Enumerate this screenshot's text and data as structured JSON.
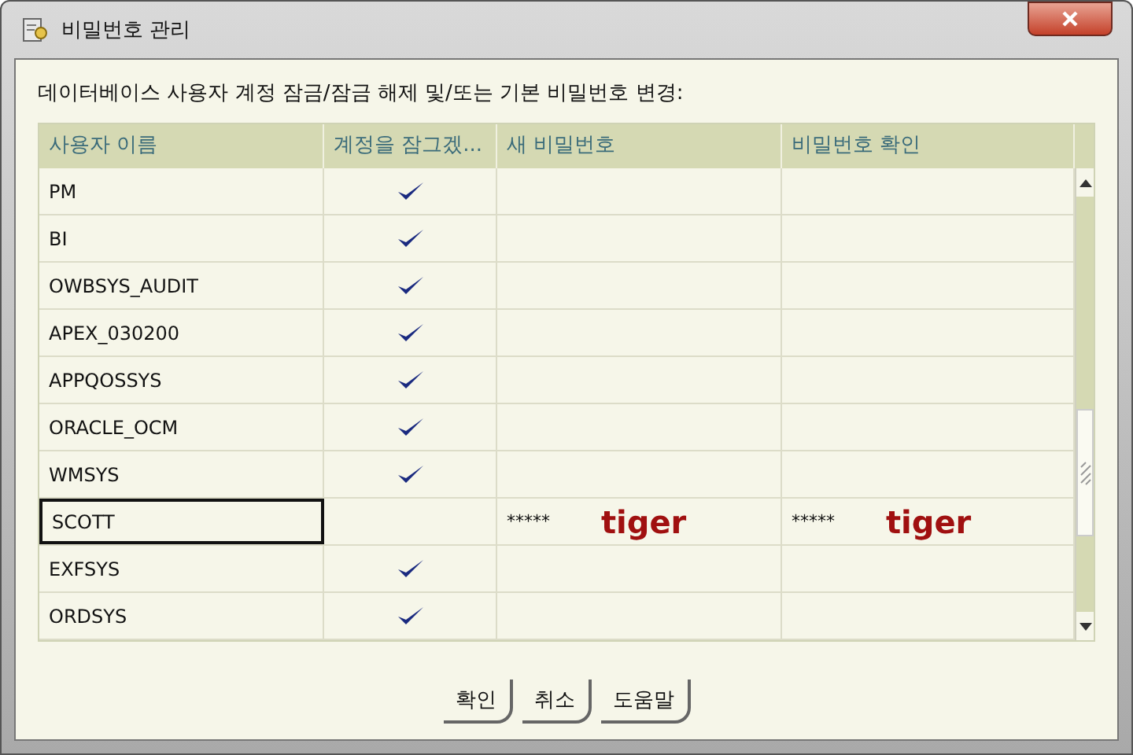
{
  "window": {
    "title": "비밀번호 관리"
  },
  "instruction": "데이터베이스 사용자 계정 잠금/잠금 해제 및/또는 기본 비밀번호 변경:",
  "table": {
    "columns": [
      "사용자 이름",
      "계정을 잠그겠...",
      "새 비밀번호",
      "비밀번호 확인"
    ],
    "rows": [
      {
        "user": "PM",
        "locked": true,
        "selected": false
      },
      {
        "user": "BI",
        "locked": true,
        "selected": false
      },
      {
        "user": "OWBSYS_AUDIT",
        "locked": true,
        "selected": false
      },
      {
        "user": "APEX_030200",
        "locked": true,
        "selected": false
      },
      {
        "user": "APPQOSSYS",
        "locked": true,
        "selected": false
      },
      {
        "user": "ORACLE_OCM",
        "locked": true,
        "selected": false
      },
      {
        "user": "WMSYS",
        "locked": true,
        "selected": false
      },
      {
        "user": "SCOTT",
        "locked": false,
        "selected": true,
        "new_password": "*****",
        "new_password_note": "tiger",
        "confirm_password": "*****",
        "confirm_password_note": "tiger"
      },
      {
        "user": "EXFSYS",
        "locked": true,
        "selected": false
      },
      {
        "user": "ORDSYS",
        "locked": true,
        "selected": false
      }
    ]
  },
  "buttons": [
    "확인",
    "취소",
    "도움말"
  ]
}
